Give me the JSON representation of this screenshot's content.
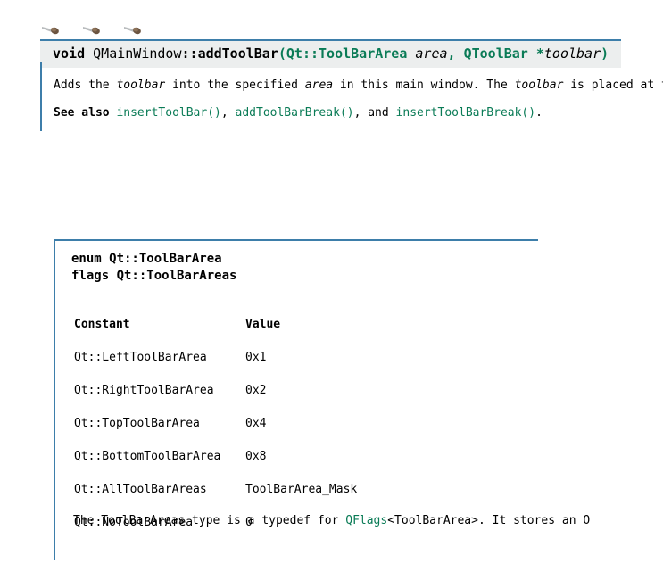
{
  "toolbar_icons": [
    {
      "name": "pin-icon-1"
    },
    {
      "name": "pin-icon-2"
    },
    {
      "name": "pin-icon-3"
    }
  ],
  "signature": {
    "return_type": "void",
    "class_name": "QMainWindow",
    "scope_operator": "::",
    "function_name": "addToolBar",
    "open_paren": "(",
    "param1_type": "Qt::ToolBarArea",
    "param1_name": "area",
    "comma": ",",
    "param2_type": "QToolBar",
    "param2_star": "*",
    "param2_name": "toolbar",
    "close_paren": ")"
  },
  "description": {
    "segments": [
      {
        "text": "Adds the ",
        "style": "plain"
      },
      {
        "text": "toolbar",
        "style": "italic"
      },
      {
        "text": " into the specified ",
        "style": "plain"
      },
      {
        "text": "area",
        "style": "italic"
      },
      {
        "text": " in this main window. The ",
        "style": "plain"
      },
      {
        "text": "toolbar",
        "style": "italic"
      },
      {
        "text": " is placed at th",
        "style": "plain"
      }
    ],
    "see_also_label": "See also",
    "see_also_links": [
      "insertToolBar()",
      "addToolBarBreak()",
      "insertToolBarBreak()"
    ],
    "see_also_separator": ", ",
    "see_also_conjunction": ", and ",
    "see_also_terminator": "."
  },
  "enum": {
    "title_line_1": "enum Qt::ToolBarArea",
    "title_line_2": "flags Qt::ToolBarAreas",
    "table": {
      "headers": [
        "Constant",
        "Value"
      ],
      "rows": [
        {
          "constant": "Qt::LeftToolBarArea",
          "value": "0x1"
        },
        {
          "constant": "Qt::RightToolBarArea",
          "value": "0x2"
        },
        {
          "constant": "Qt::TopToolBarArea",
          "value": "0x4"
        },
        {
          "constant": "Qt::BottomToolBarArea",
          "value": "0x8"
        },
        {
          "constant": "Qt::AllToolBarAreas",
          "value": "ToolBarArea_Mask"
        },
        {
          "constant": "Qt::NoToolBarArea",
          "value": "0"
        }
      ]
    },
    "note": {
      "prefix": "The ToolBarAreas type is a typedef for ",
      "link_prefix": "QFlags",
      "link_suffix": "<ToolBarArea>",
      "suffix": ". It stores an O"
    }
  },
  "colors": {
    "accent_rule": "#3d7eaa",
    "signature_bg": "#eceeee",
    "link_green": "#0a7b56",
    "text": "#000000",
    "page_bg": "#ffffff"
  }
}
